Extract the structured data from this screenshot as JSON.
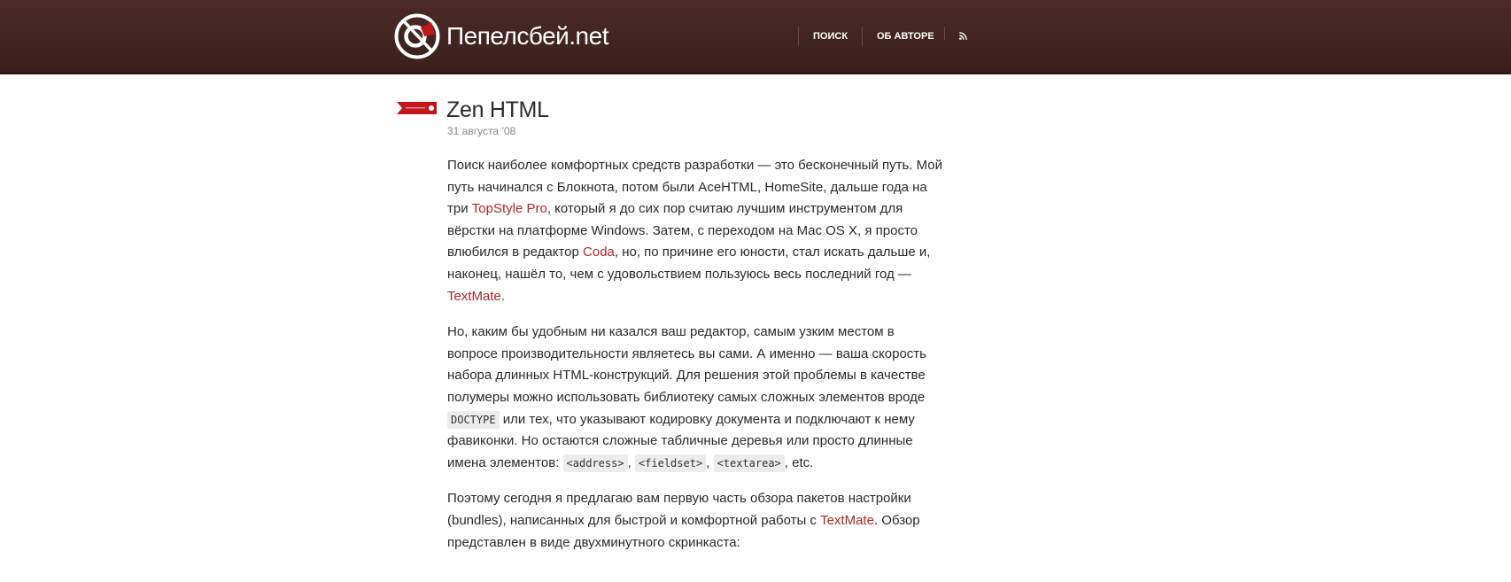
{
  "header": {
    "site_name": "Пепелсбей.net",
    "nav": {
      "search": "ПОИСК",
      "about": "ОБ АВТОРЕ",
      "rss_icon": "rss-icon"
    },
    "colors": {
      "background": "#3d2320",
      "accent": "#c0171d"
    }
  },
  "post": {
    "title": "Zen HTML",
    "date": "31 августа ’08",
    "p1": {
      "t1": "Поиск наиболее комфортных средств разработки — это бесконечный путь. Мой путь начинался с Блокнота, потом были AceHTML, HomeSite, дальше года на три ",
      "link_topstyle": "TopStyle Pro",
      "t2": ", который я до сих пор считаю лучшим инструментом для вёрстки на платформе Windows. Затем, с переходом на Mac OS X, я просто влюбился в редактор ",
      "link_coda": "Coda",
      "t3": ", но, по причине его юности, стал искать дальше и, наконец, нашёл то, чем с удовольствием пользуюсь весь последний год — ",
      "link_textmate": "TextMate",
      "t4": "."
    },
    "p2": {
      "t1": "Но, каким бы удобным ни казался ваш редактор, самым узким местом в вопросе производительности являетесь вы сами. А именно — ваша скорость набора длинных HTML-конструкций. Для решения этой проблемы в качестве полумеры можно использовать библиотеку самых сложных элементов вроде ",
      "code_doctype": "DOCTYPE",
      "t2": " или тех, что указывают кодировку документа и подключают к нему фавиконки. Но остаются сложные табличные деревья или просто длинные имена элементов: ",
      "code_address": "<address>",
      "sep1": ", ",
      "code_fieldset": "<fieldset>",
      "sep2": ", ",
      "code_textarea": "<textarea>",
      "t3": ", etc."
    },
    "p3": {
      "t1": "Поэтому сегодня я предлагаю вам первую часть обзора пакетов настройки (bundles), написанных для быстрой и комфортной работы с ",
      "link_textmate": "TextMate",
      "t2": ". Обзор представлен в виде двухминутного скринкаста:"
    }
  }
}
